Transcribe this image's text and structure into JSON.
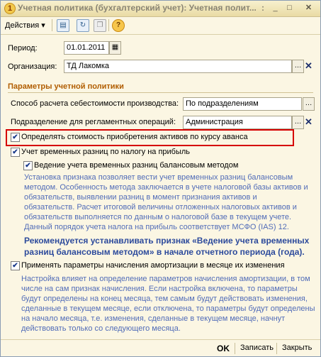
{
  "window": {
    "title": "Учетная политика (бухгалтерский учет): Учетная полит... : _ □ ×",
    "title_short": "Учетная политика (бухгалтерский учет): Учетная полит...",
    "title_dots": ":",
    "title_icon": "1c-icon"
  },
  "toolbar": {
    "actions_label": "Действия",
    "actions_arrow": "▾",
    "icons": [
      "save-icon",
      "refresh-icon",
      "copy-icon",
      "help-icon"
    ]
  },
  "form": {
    "period_label": "Период:",
    "period_value": "01.01.2011",
    "org_label": "Организация:",
    "org_value": "ТД Лакомка"
  },
  "section": {
    "title": "Параметры учетной политики"
  },
  "params": {
    "cost_method_label": "Способ расчета себестоимости производства:",
    "cost_method_value": "По подразделениям",
    "dept_label": "Подразделение для регламентных операций:",
    "dept_value": "Администрация"
  },
  "checkboxes": {
    "advance_rate_label": "Определять стоимость приобретения активов по курсу аванса",
    "advance_rate_checked": true,
    "temp_diff_label": "Учет временных разниц по налогу на прибыль",
    "temp_diff_checked": true,
    "balance_method_label": "Ведение учета временных разниц балансовым методом",
    "balance_method_checked": true,
    "amort_label": "Применять параметры начисления амортизации в месяце их изменения",
    "amort_checked": true
  },
  "desc": {
    "balance_lines": [
      "Установка признака позволяет вести учет временных разниц балансовым",
      "методом.  Особенность метода заключается в учете налоговой базы активов и",
      "обязательств, выявлении разниц  в момент признания активов и",
      "обязательств. Расчет итоговой величины отложенных налоговых активов и",
      "обязательств выполняется по данным о налоговой базе в текущем учете.",
      "Данный порядок учета налога на прибыль соответствует МСФО (IAS)  12."
    ],
    "recommend_lines": [
      "Рекомендуется устанавливать признак «Ведение учета временных",
      "разниц балансовым методом» в начале отчетного периода (года)."
    ],
    "amort_lines": [
      "Настройка влияет на определение параметров  начисления амортизации, в том",
      "числе на сам признак начисления. Если настройка включена, то параметры",
      "будут определены на конец месяца, тем самым будут действовать изменения,",
      "сделанные в текущем месяце, если отключена, то параметры будут определены",
      "на начало месяца, т.е. изменения, сделанные в текущем месяце, начнут",
      "действовать только со следующего месяца."
    ]
  },
  "buttons": {
    "ok": "OK",
    "save": "Записать",
    "close": "Закрыть"
  },
  "colors": {
    "background": "#fbf6e3",
    "section_title": "#b15d00",
    "description": "#516cb8",
    "highlight": "#d60000"
  }
}
